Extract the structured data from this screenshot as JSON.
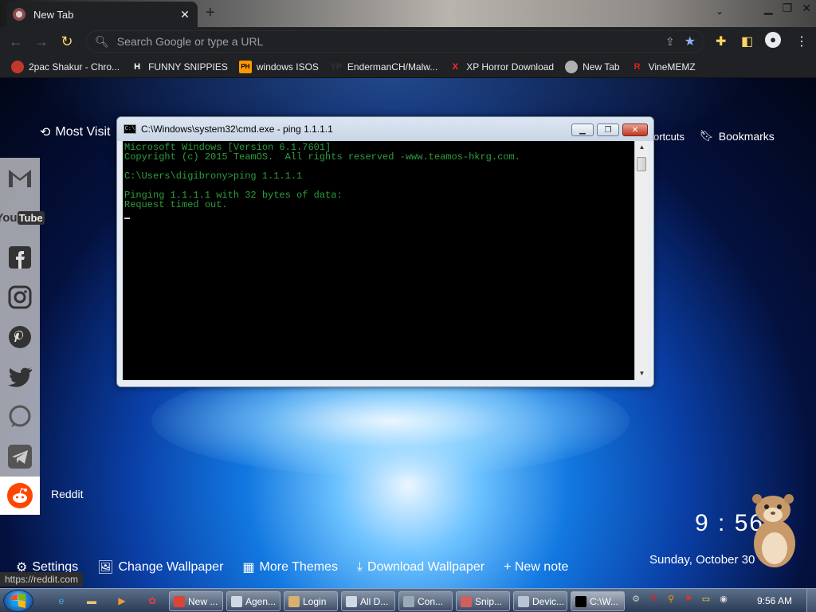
{
  "browser": {
    "tab_title": "New Tab",
    "tab_close": "✕",
    "new_tab": "+",
    "address_placeholder": "Search Google or type a URL",
    "bookmarks": [
      {
        "label": "2pac Shakur - Chro...",
        "icon": "2pac-favicon",
        "icon_char": "",
        "color": "#c0392b"
      },
      {
        "label": "FUNNY SNIPPIES",
        "icon": "h-icon",
        "icon_char": "H",
        "color": "#ffffff"
      },
      {
        "label": "windows ISOS",
        "icon": "ph-icon",
        "icon_char": "PH",
        "color": "#ff9900"
      },
      {
        "label": "EndermanCH/Malw...",
        "icon": "github-icon",
        "icon_char": "YP",
        "color": "#333333"
      },
      {
        "label": "XP Horror Download",
        "icon": "x-icon",
        "icon_char": "X",
        "color": "#ff2d2d"
      },
      {
        "label": "New Tab",
        "icon": "new-tab-favicon",
        "icon_char": "",
        "color": "#b0b0b0"
      },
      {
        "label": "VineMEMZ",
        "icon": "r-icon",
        "icon_char": "R",
        "color": "#e02020"
      }
    ]
  },
  "newtab": {
    "most_visited": "Most Visit",
    "shortcuts": "ortcuts",
    "bookmarks_link": "Bookmarks",
    "reddit_label": "Reddit",
    "clock_time": "9 : 56",
    "clock_date": "Sunday, October 30",
    "status_url": "https://reddit.com",
    "bottom_links": {
      "settings": "Settings",
      "change_wallpaper": "Change Wallpaper",
      "more_themes": "More Themes",
      "download_wallpaper": "Download Wallpaper",
      "new_note": "+ New note"
    },
    "social_icons": [
      "gmail-icon",
      "youtube-icon",
      "facebook-icon",
      "instagram-icon",
      "pinterest-icon",
      "twitter-icon",
      "whatsapp-icon",
      "telegram-icon",
      "reddit-icon"
    ]
  },
  "cmd": {
    "title": "C:\\Windows\\system32\\cmd.exe - ping  1.1.1.1",
    "lines": [
      "Microsoft Windows [Version 6.1.7601]",
      "Copyright (c) 2015 TeamOS.  All rights reserved -www.teamos-hkrg.com.",
      "",
      "C:\\Users\\digibrony>ping 1.1.1.1",
      "",
      "Pinging 1.1.1.1 with 32 bytes of data:",
      "Request timed out."
    ]
  },
  "taskbar": {
    "items": [
      {
        "label": "New ...",
        "icon": "chrome-icon",
        "color": "#db4437",
        "active": false
      },
      {
        "label": "Agen...",
        "icon": "window-icon",
        "color": "#cfd8e3",
        "active": false
      },
      {
        "label": "Login",
        "icon": "login-icon",
        "color": "#d8b070",
        "active": false
      },
      {
        "label": "All D...",
        "icon": "folder-window-icon",
        "color": "#cfd8e3",
        "active": false
      },
      {
        "label": "Con...",
        "icon": "control-icon",
        "color": "#9aa8b8",
        "active": false
      },
      {
        "label": "Snip...",
        "icon": "snipping-icon",
        "color": "#d06060",
        "active": false
      },
      {
        "label": "Devic...",
        "icon": "device-icon",
        "color": "#b8c4d4",
        "active": false
      },
      {
        "label": "C:\\W...",
        "icon": "cmd-icon",
        "color": "#000000",
        "active": true
      }
    ],
    "time": "9:56 AM"
  }
}
